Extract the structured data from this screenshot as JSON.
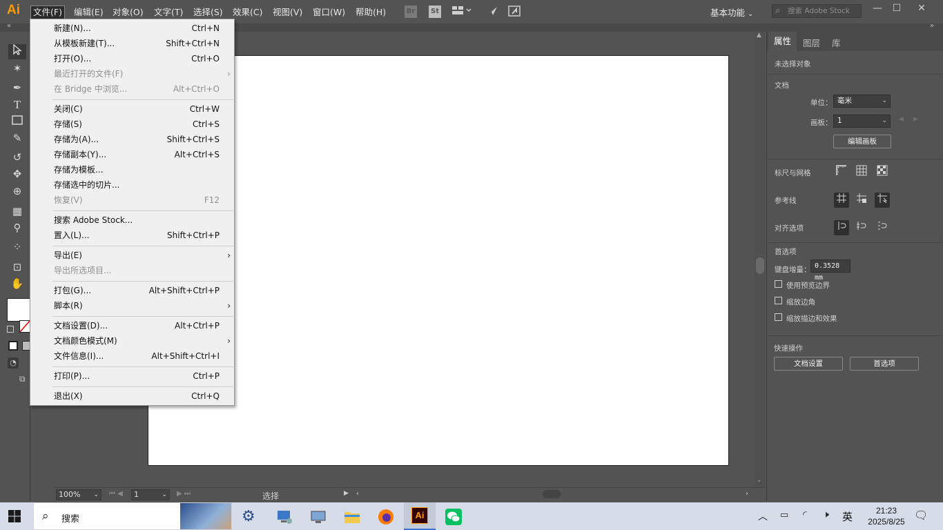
{
  "app": {
    "logo_text": "Ai",
    "workspace": "基本功能",
    "stock_search_placeholder": "搜索 Adobe Stock"
  },
  "menubar": {
    "items": [
      "文件(F)",
      "编辑(E)",
      "对象(O)",
      "文字(T)",
      "选择(S)",
      "效果(C)",
      "视图(V)",
      "窗口(W)",
      "帮助(H)"
    ],
    "icons": {
      "bridge": "Br",
      "stock": "St"
    }
  },
  "file_menu": {
    "items": [
      {
        "label": "新建(N)...",
        "shortcut": "Ctrl+N"
      },
      {
        "label": "从模板新建(T)...",
        "shortcut": "Shift+Ctrl+N"
      },
      {
        "label": "打开(O)...",
        "shortcut": "Ctrl+O"
      },
      {
        "label": "最近打开的文件(F)",
        "shortcut": ""
      },
      {
        "label": "在 Bridge 中浏览...",
        "shortcut": "Alt+Ctrl+O"
      },
      {
        "label": "关闭(C)",
        "shortcut": "Ctrl+W"
      },
      {
        "label": "存储(S)",
        "shortcut": "Ctrl+S"
      },
      {
        "label": "存储为(A)...",
        "shortcut": "Shift+Ctrl+S"
      },
      {
        "label": "存储副本(Y)...",
        "shortcut": "Alt+Ctrl+S"
      },
      {
        "label": "存储为模板...",
        "shortcut": ""
      },
      {
        "label": "存储选中的切片...",
        "shortcut": ""
      },
      {
        "label": "恢复(V)",
        "shortcut": "F12"
      },
      {
        "label": "搜索 Adobe Stock...",
        "shortcut": ""
      },
      {
        "label": "置入(L)...",
        "shortcut": "Shift+Ctrl+P"
      },
      {
        "label": "导出(E)",
        "shortcut": ""
      },
      {
        "label": "导出所选项目...",
        "shortcut": ""
      },
      {
        "label": "打包(G)...",
        "shortcut": "Alt+Shift+Ctrl+P"
      },
      {
        "label": "脚本(R)",
        "shortcut": ""
      },
      {
        "label": "文档设置(D)...",
        "shortcut": "Alt+Ctrl+P"
      },
      {
        "label": "文档颜色模式(M)",
        "shortcut": ""
      },
      {
        "label": "文件信息(I)...",
        "shortcut": "Alt+Shift+Ctrl+I"
      },
      {
        "label": "打印(P)...",
        "shortcut": "Ctrl+P"
      },
      {
        "label": "退出(X)",
        "shortcut": "Ctrl+Q"
      }
    ]
  },
  "panel": {
    "tabs": [
      "属性",
      "图层",
      "库"
    ],
    "no_selection": "未选择对象",
    "document_section": "文档",
    "unit_label": "单位：",
    "unit_value": "毫米",
    "artboard_label": "画板：",
    "artboard_value": "1",
    "edit_artboard_button": "编辑画板",
    "rulers_grids": "标尺与网格",
    "guides": "参考线",
    "snap_options": "对齐选项",
    "preferences_section": "首选项",
    "keyboard_increment_label": "键盘增量：",
    "keyboard_increment_value": "0.3528 mm",
    "use_preview_bounds": "使用预览边界",
    "scale_corners": "缩放边角",
    "scale_strokes_effects": "缩放描边和效果",
    "quick_actions": "快速操作",
    "doc_setup_button": "文档设置",
    "preferences_button": "首选项"
  },
  "status": {
    "zoom": "100%",
    "artboard": "1",
    "tool": "选择"
  },
  "taskbar": {
    "search_label": "搜索",
    "ime": "英",
    "time": "21:23",
    "date": "2025/8/25"
  }
}
